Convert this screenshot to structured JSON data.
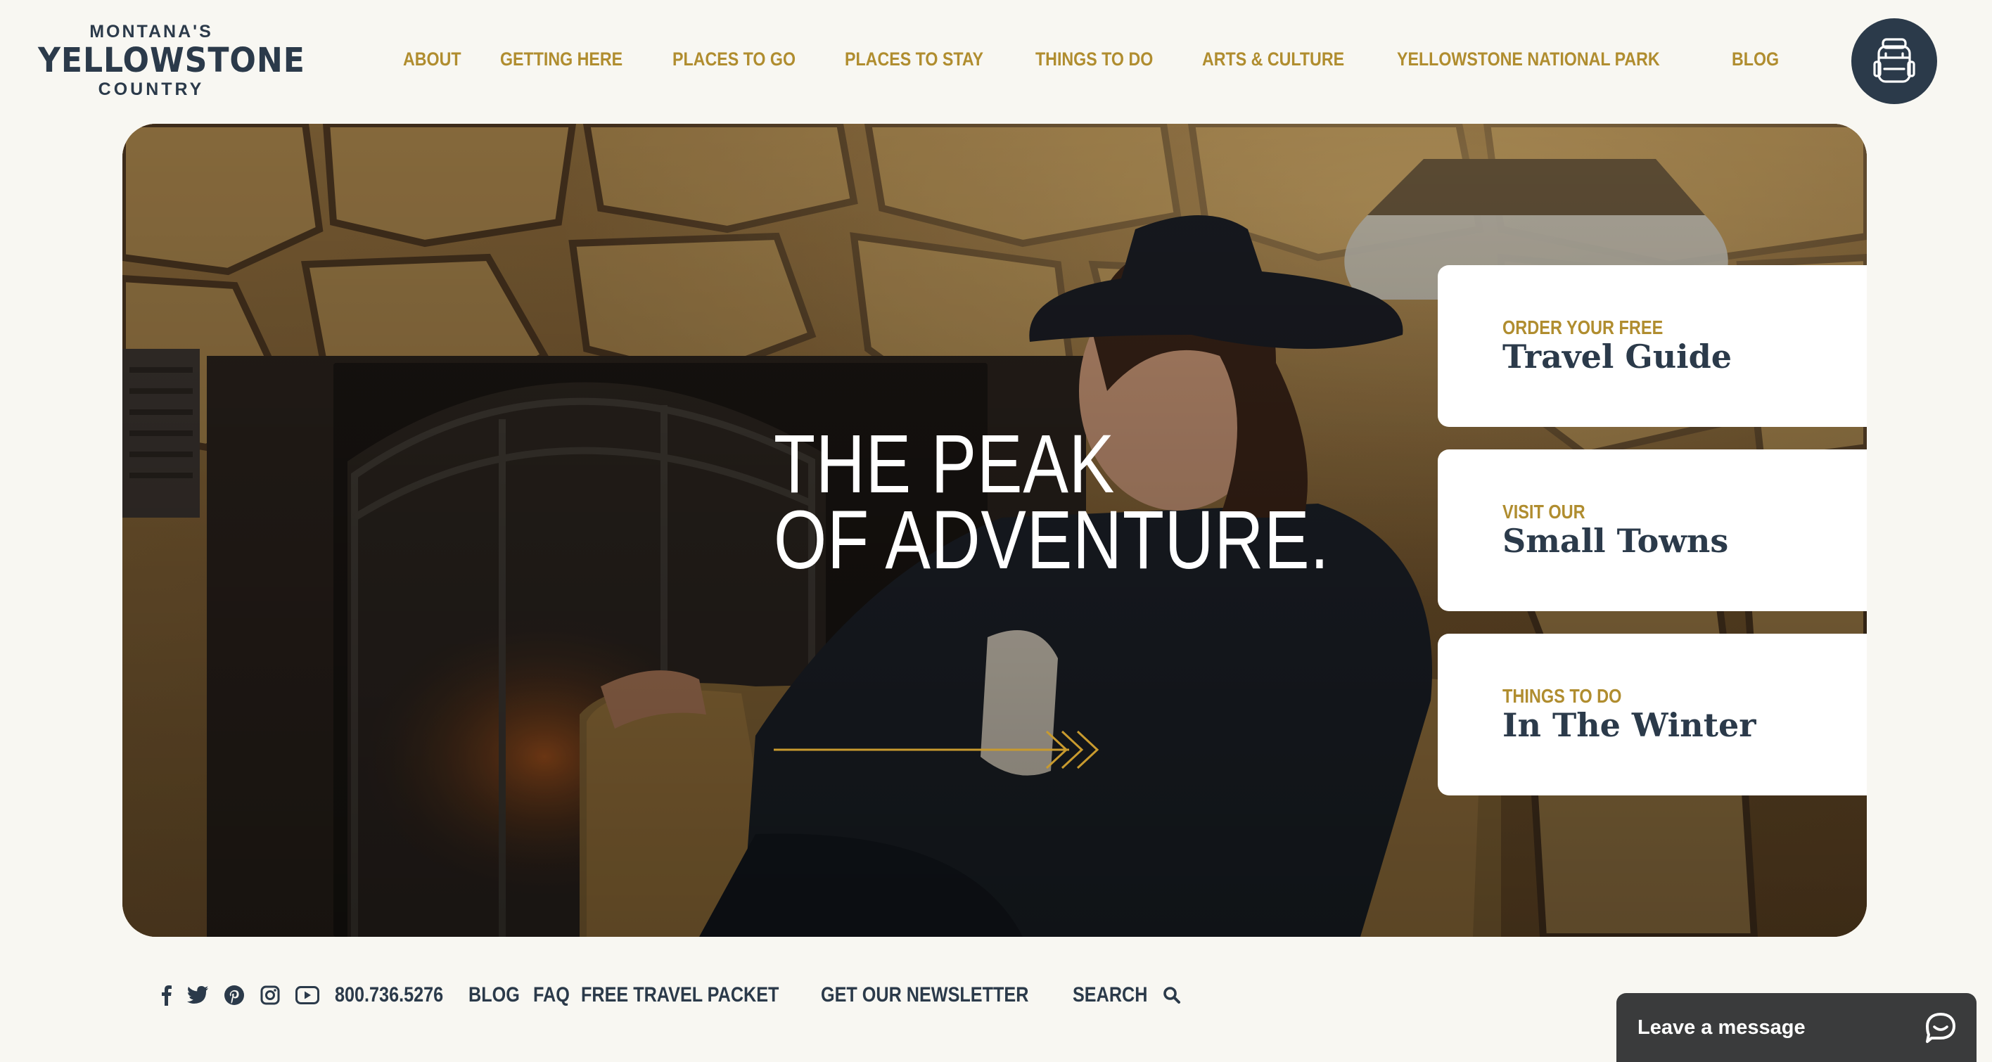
{
  "logo": {
    "top": "MONTANA'S",
    "main": "YELLOWSTONE",
    "bottom": "COUNTRY"
  },
  "nav": {
    "items": [
      {
        "label": "ABOUT"
      },
      {
        "label": "GETTING HERE"
      },
      {
        "label": "PLACES TO GO"
      },
      {
        "label": "PLACES TO STAY"
      },
      {
        "label": "THINGS TO DO"
      },
      {
        "label": "ARTS & CULTURE"
      },
      {
        "label": "YELLOWSTONE NATIONAL PARK"
      },
      {
        "label": "BLOG"
      }
    ]
  },
  "header_button": {
    "icon": "backpack-icon"
  },
  "hero": {
    "headline_line1": "THE PEAK",
    "headline_line2": "OF ADVENTURE.",
    "cards": [
      {
        "kicker": "ORDER YOUR FREE",
        "title": "Travel Guide"
      },
      {
        "kicker": "VISIT OUR",
        "title": "Small Towns"
      },
      {
        "kicker": "THINGS TO DO",
        "title": "In The Winter"
      }
    ]
  },
  "utility": {
    "social_icons": [
      "facebook-icon",
      "twitter-icon",
      "pinterest-icon",
      "instagram-icon",
      "youtube-icon"
    ],
    "phone": "800.736.5276",
    "blog": "BLOG",
    "faq": "FAQ",
    "travel_packet": "FREE TRAVEL PACKET",
    "newsletter": "GET OUR NEWSLETTER",
    "search": "SEARCH"
  },
  "chat": {
    "label": "Leave a message"
  },
  "colors": {
    "background": "#f8f7f2",
    "navy": "#2b3a4a",
    "gold": "#b08d2f",
    "chat": "#3a3b3c"
  }
}
